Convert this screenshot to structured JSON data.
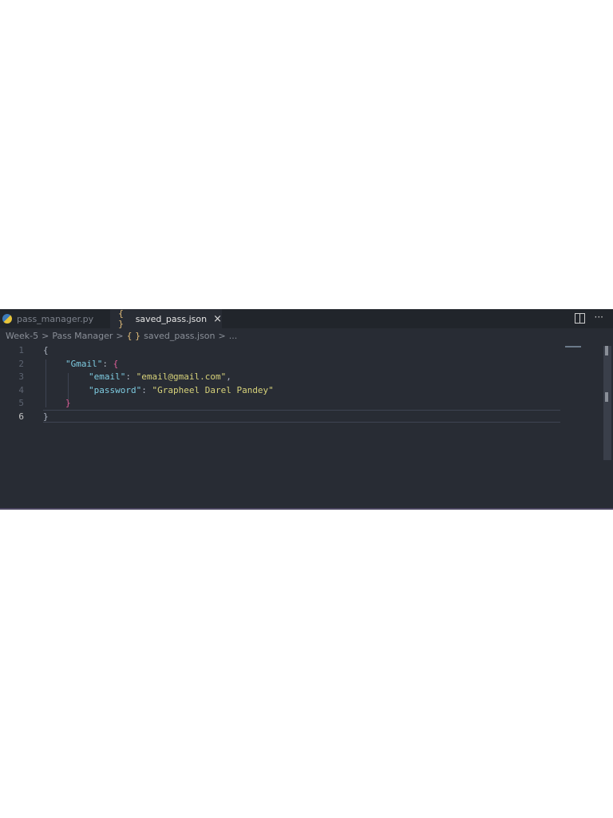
{
  "tabs": [
    {
      "label": "pass_manager.py",
      "icon": "python-icon",
      "active": false
    },
    {
      "label": "saved_pass.json",
      "icon": "json-braces-icon",
      "active": true,
      "close": "×"
    }
  ],
  "actions": {
    "more": "···"
  },
  "breadcrumb": {
    "items": [
      "Week-5",
      "Pass Manager",
      "saved_pass.json",
      "..."
    ],
    "sep": ">",
    "json_icon": "{ }"
  },
  "editor": {
    "line_numbers": [
      "1",
      "2",
      "3",
      "4",
      "5",
      "6"
    ],
    "lines": [
      {
        "open": "{"
      },
      {
        "key": "\"Gmail\"",
        "colon": ": ",
        "brace": "{"
      },
      {
        "key": "\"email\"",
        "colon": ": ",
        "value": "\"email@gmail.com\"",
        "comma": ","
      },
      {
        "key": "\"password\"",
        "colon": ": ",
        "value": "\"Grapheel Darel Pandey\""
      },
      {
        "close": "}"
      },
      {
        "close": "}"
      }
    ]
  }
}
